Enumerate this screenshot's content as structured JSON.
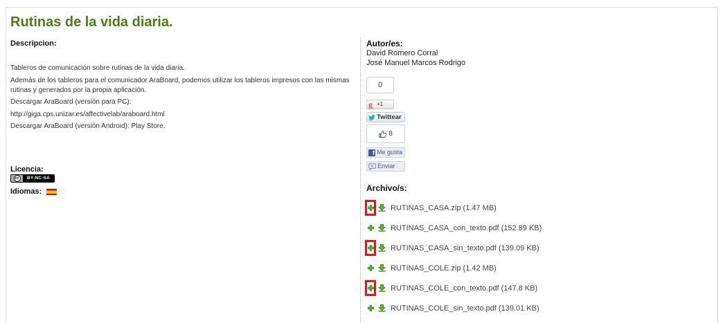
{
  "page": {
    "title": "Rutinas de la vida diaria."
  },
  "description": {
    "heading": "Descripcion:",
    "paragraphs": [
      "Tableros de comunicación sobre rutinas de la vida diaria.",
      "Además de los tableros para el comunicador AraBoard, podemos utilizar los tableros impresos con las mismas rutinas y generados por la propia aplicación.",
      "Descargar AraBoard (versión para PC):",
      "http://giga.cps.unizar.es/affectivelab/araboard.html",
      "Descargar AraBoard (versión Android): Play Store."
    ]
  },
  "license": {
    "heading": "Licencia:",
    "badge_logo": "cc",
    "badge_text": "BY-NC-SA"
  },
  "languages": {
    "heading": "Idiomas:",
    "flag_icon": "spain-flag-icon"
  },
  "authors": {
    "heading": "Autor/es:",
    "names": [
      "David Romero Corral",
      "José Manuel Marcos Rodrigo"
    ]
  },
  "social": {
    "gplus_count": "0",
    "gplus_logo_letter": "g",
    "gplus_label": "+1",
    "twitter_icon": "twitter-bird-icon",
    "twitter_label": "Twittear",
    "fb_like_icon": "thumbs-up-icon",
    "fb_count": "8",
    "fb_logo_letter": "f",
    "fb_like_label": "Me gusta",
    "fb_send_icon": "send-bubble-icon",
    "fb_send_label": "Enviar"
  },
  "files": {
    "heading": "Archivo/s:",
    "add_icon": "plus-icon",
    "download_icon": "download-icon",
    "items": [
      {
        "name": "RUTINAS_CASA.zip",
        "size": "(1.47 MB)",
        "highlighted": true
      },
      {
        "name": "RUTINAS_CASA_con_texto.pdf",
        "size": "(152.89 KB)",
        "highlighted": false
      },
      {
        "name": "RUTINAS_CASA_sin_texto.pdf",
        "size": "(139.09 KB)",
        "highlighted": true
      },
      {
        "name": "RUTINAS_COLE.zip",
        "size": "(1.42 MB)",
        "highlighted": false
      },
      {
        "name": "RUTINAS_COLE_con_texto.pdf",
        "size": "(147.8 KB)",
        "highlighted": true
      },
      {
        "name": "RUTINAS_COLE_sin_texto.pdf",
        "size": "(139.01 KB)",
        "highlighted": false
      }
    ]
  },
  "colors": {
    "title": "#4c7d15",
    "highlight": "#e3161b",
    "icon_green": "#5cb82e",
    "facebook": "#3b5998",
    "twitter": "#2aa9e0",
    "google": "#dd4b39"
  }
}
